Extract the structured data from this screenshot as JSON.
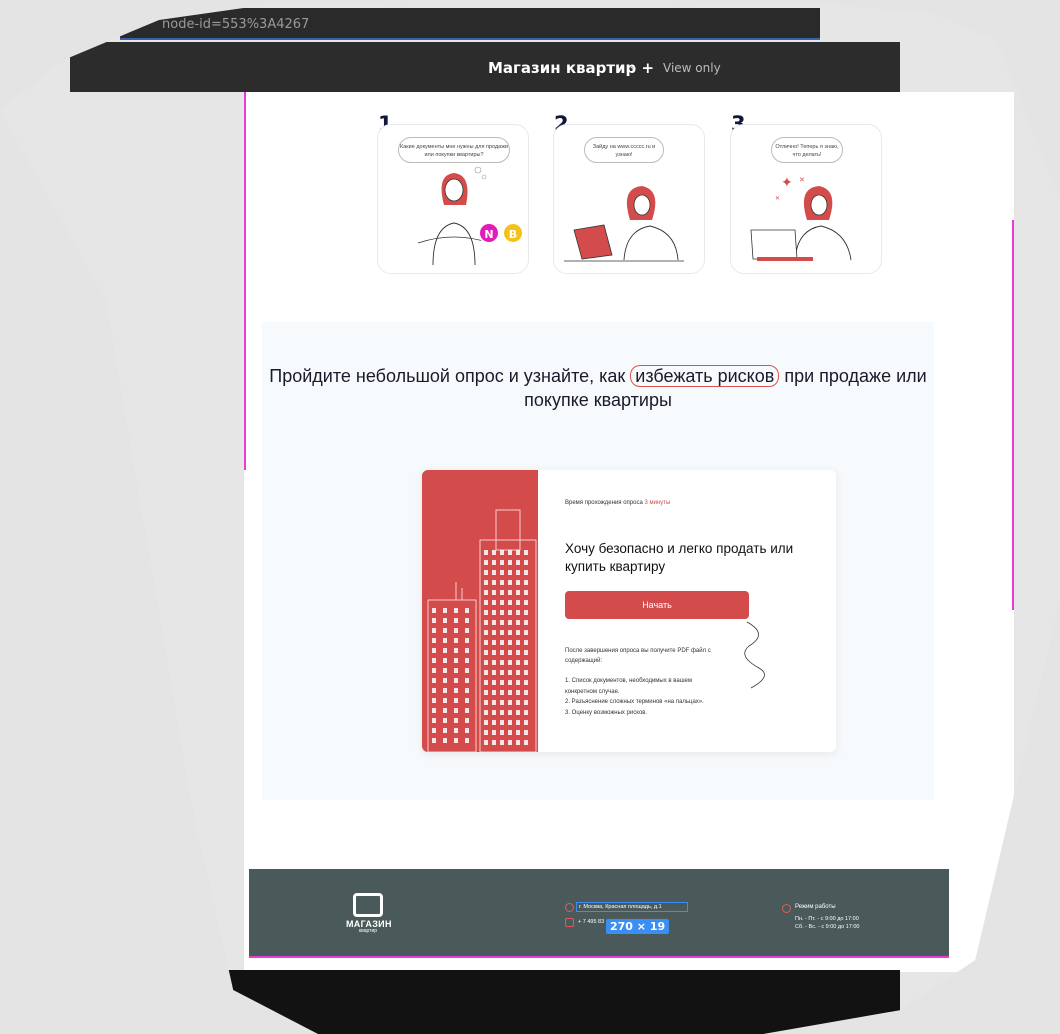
{
  "browser": {
    "url_fragment": "node-id=553%3A4267"
  },
  "toolbar": {
    "file_title": "Магазин квартир +",
    "view_mode": "View only"
  },
  "steps": [
    {
      "number": "1",
      "bubble": "Какие документы мне нужны для продажи или покупки квартиры?"
    },
    {
      "number": "2",
      "bubble": "Зайду на www.ccccc.ru и узнаю!"
    },
    {
      "number": "3",
      "bubble": "Отлично! Теперь я знаю, что делать!"
    }
  ],
  "collaborators": [
    {
      "initial": "N",
      "color": "#e21cb8"
    },
    {
      "initial": "B",
      "color": "#f5c21b"
    }
  ],
  "survey": {
    "heading_before": "Пройдите небольшой опрос и узнайте, как",
    "heading_highlight": "избежать рисков",
    "heading_after": "при продаже или покупке квартиры",
    "time_label": "Время прохождения опроса",
    "time_value": "3 минуты",
    "card_title": "Хочу безопасно и легко продать или купить квартиру",
    "start_button": "Начать",
    "after_text": "После завершения опроса вы получите PDF файл с содержащий:",
    "items": [
      "1. Список документов, необходимых в вашем конкретном случае.",
      "2. Разъяснение сложных терминов «на пальцах».",
      "3. Оценку возможных рисков."
    ]
  },
  "footer": {
    "logo_line1": "МАГАЗИН",
    "logo_line2": "квартир",
    "address": "г. Москва, Красная площадь, д.1",
    "phone": "+ 7 495 83",
    "selection_dims": "270 × 19",
    "hours_title": "Режим работы",
    "hours_weekdays": "Пн. - Пт. - с 9:00 до 17:00",
    "hours_weekend": "Сб. - Вс. - с 9:00 до 17:00"
  },
  "colors": {
    "accent": "#d44b4b",
    "footer": "#4a5a5b",
    "guide": "#e83bd3",
    "selection": "#3a8ef6"
  }
}
